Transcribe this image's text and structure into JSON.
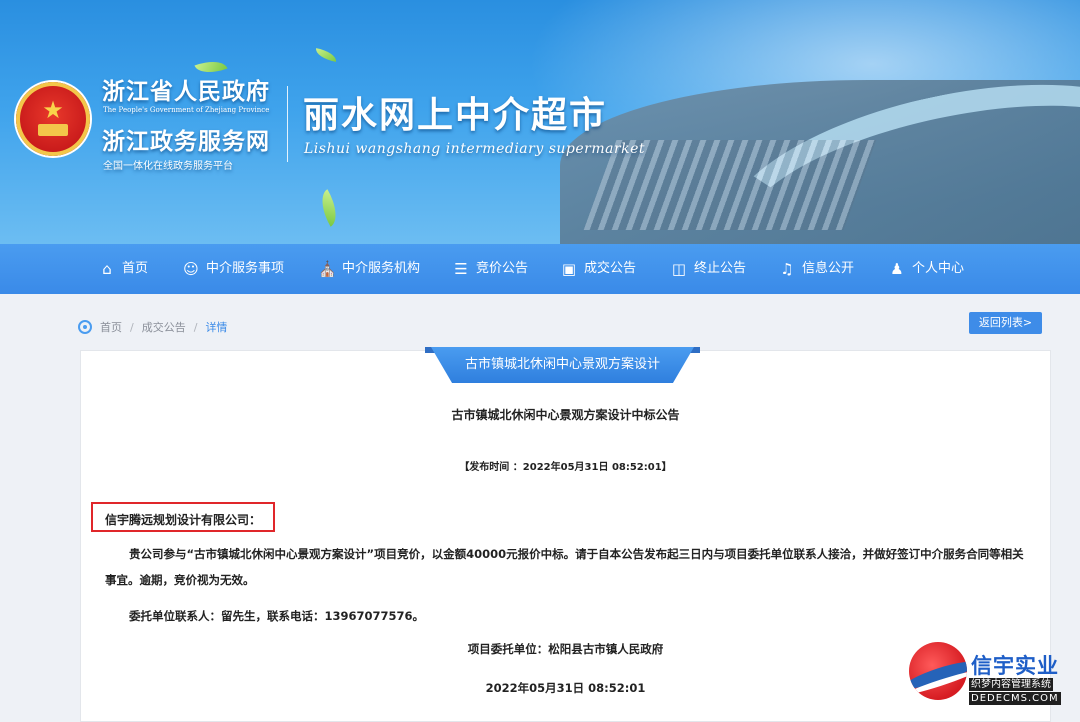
{
  "header": {
    "gov_name": "浙江省人民政府",
    "gov_name_en": "The People's Government of Zhejiang Province",
    "service_name": "浙江政务服务网",
    "service_sub": "全国一体化在线政务服务平台",
    "site_title": "丽水网上中介超市",
    "site_title_en": "Lishui wangshang intermediary supermarket",
    "emblem_icon": "national-emblem-icon"
  },
  "nav": {
    "items": [
      {
        "label": "首页",
        "icon": "home-icon"
      },
      {
        "label": "中介服务事项",
        "icon": "user-service-icon"
      },
      {
        "label": "中介服务机构",
        "icon": "institution-icon"
      },
      {
        "label": "竞价公告",
        "icon": "cart-icon"
      },
      {
        "label": "成交公告",
        "icon": "briefcase-icon"
      },
      {
        "label": "终止公告",
        "icon": "trash-icon"
      },
      {
        "label": "信息公开",
        "icon": "bell-icon"
      },
      {
        "label": "个人中心",
        "icon": "person-icon"
      }
    ],
    "bg_color": "#3a8ae8"
  },
  "breadcrumb": {
    "items": [
      "首页",
      "成交公告",
      "详情"
    ],
    "separator": "/"
  },
  "back_button": {
    "label": "返回列表>"
  },
  "notice": {
    "tab_title": "古市镇城北休闲中心景观方案设计",
    "title": "古市镇城北休闲中心景观方案设计中标公告",
    "publish_time": "【发布时间 ：2022年05月31日 08:52:01】",
    "addressee": "信宇腾远规划设计有限公司：",
    "paragraph_1": "贵公司参与“古市镇城北休闲中心景观方案设计”项目竞价，以金额40000元报价中标。请于自本公告发布起三日内与项目委托单位联系人接洽，并做好签订中介服务合同等相关事宜。逾期，竞价视为无效。",
    "paragraph_2": "委托单位联系人：留先生，联系电话：13967077576。",
    "signer": "项目委托单位：松阳县古市镇人民政府",
    "sign_date": "2022年05月31日 08:52:01",
    "highlight_color": "#e0262a"
  },
  "watermark": {
    "name": "信宇实业",
    "sub": "织梦内容管理系统",
    "url": "DEDECMS.COM"
  }
}
